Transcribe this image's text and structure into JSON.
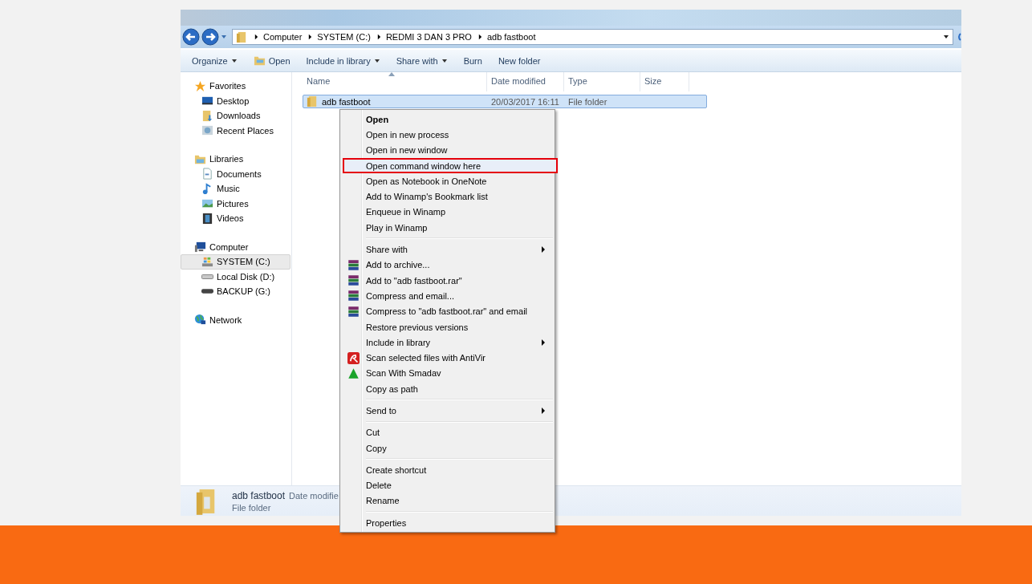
{
  "address_bar": {
    "crumbs": [
      "Computer",
      "SYSTEM (C:)",
      "REDMI 3 DAN 3 PRO",
      "adb fastboot"
    ]
  },
  "toolbar": [
    {
      "label": "Organize",
      "dropdown": true
    },
    {
      "label": "Open",
      "dropdown": false
    },
    {
      "label": "Include in library",
      "dropdown": true
    },
    {
      "label": "Share with",
      "dropdown": true
    },
    {
      "label": "Burn",
      "dropdown": false
    },
    {
      "label": "New folder",
      "dropdown": false
    }
  ],
  "sidebar": {
    "groups": [
      {
        "label": "Favorites",
        "selected": false,
        "children": [
          {
            "label": "Desktop",
            "selected": false
          },
          {
            "label": "Downloads",
            "selected": false
          },
          {
            "label": "Recent Places",
            "selected": false
          }
        ]
      },
      {
        "label": "Libraries",
        "selected": false,
        "children": [
          {
            "label": "Documents",
            "selected": false
          },
          {
            "label": "Music",
            "selected": false
          },
          {
            "label": "Pictures",
            "selected": false
          },
          {
            "label": "Videos",
            "selected": false
          }
        ]
      },
      {
        "label": "Computer",
        "selected": false,
        "children": [
          {
            "label": "SYSTEM (C:)",
            "selected": true
          },
          {
            "label": "Local Disk (D:)",
            "selected": false
          },
          {
            "label": "BACKUP (G:)",
            "selected": false
          }
        ]
      },
      {
        "label": "Network",
        "selected": false
      }
    ]
  },
  "table": {
    "columns": [
      "Name",
      "Date modified",
      "Type",
      "Size"
    ],
    "rows": [
      {
        "name": "adb fastboot",
        "date_modified": "20/03/2017 16:11",
        "type": "File folder",
        "selected": true
      }
    ]
  },
  "context_menu": {
    "groups": [
      [
        {
          "label": "Open",
          "kind": "default",
          "annotated": false
        },
        {
          "label": "Open in new process",
          "kind": "plain",
          "annotated": false
        },
        {
          "label": "Open in new window",
          "kind": "plain",
          "annotated": false
        },
        {
          "label": "Open command window here",
          "kind": "plain",
          "annotated": true
        },
        {
          "label": "Open as Notebook in OneNote",
          "kind": "plain",
          "annotated": false
        },
        {
          "label": "Add to Winamp's Bookmark list",
          "kind": "plain",
          "annotated": false
        },
        {
          "label": "Enqueue in Winamp",
          "kind": "plain",
          "annotated": false
        },
        {
          "label": "Play in Winamp",
          "kind": "plain",
          "annotated": false
        }
      ],
      [
        {
          "label": "Share with",
          "kind": "submenu",
          "annotated": false
        },
        {
          "label": "Add to archive...",
          "kind": "archive",
          "annotated": false
        },
        {
          "label": "Add to \"adb fastboot.rar\"",
          "kind": "archive",
          "annotated": false
        },
        {
          "label": "Compress and email...",
          "kind": "archive",
          "annotated": false
        },
        {
          "label": "Compress to \"adb fastboot.rar\" and email",
          "kind": "archive",
          "annotated": false
        },
        {
          "label": "Restore previous versions",
          "kind": "plain",
          "annotated": false
        },
        {
          "label": "Include in library",
          "kind": "submenu",
          "annotated": false
        },
        {
          "label": "Scan selected files with AntiVir",
          "kind": "antivirus",
          "annotated": false
        },
        {
          "label": "Scan With Smadav",
          "kind": "triangle",
          "annotated": false
        },
        {
          "label": "Copy as path",
          "kind": "plain",
          "annotated": false
        }
      ],
      [
        {
          "label": "Send to",
          "kind": "submenu",
          "annotated": false
        }
      ],
      [
        {
          "label": "Cut",
          "kind": "plain",
          "annotated": false
        },
        {
          "label": "Copy",
          "kind": "plain",
          "annotated": false
        }
      ],
      [
        {
          "label": "Create shortcut",
          "kind": "plain",
          "annotated": false
        },
        {
          "label": "Delete",
          "kind": "plain",
          "annotated": false
        },
        {
          "label": "Rename",
          "kind": "plain",
          "annotated": false
        }
      ],
      [
        {
          "label": "Properties",
          "kind": "plain",
          "annotated": false
        }
      ]
    ]
  },
  "details_pane": {
    "name": "adb fastboot",
    "field": "Date modifie",
    "type": "File folder"
  }
}
